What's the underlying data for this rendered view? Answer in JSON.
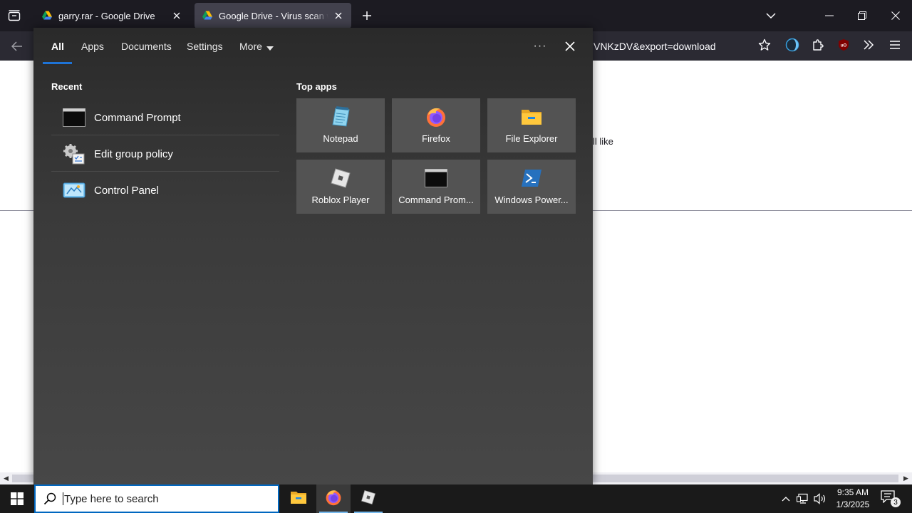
{
  "browser": {
    "tabs": [
      {
        "title": "garry.rar - Google Drive",
        "favicon": "google-drive-icon",
        "active": false
      },
      {
        "title": "Google Drive - Virus scan warning",
        "favicon": "google-drive-icon",
        "active": true
      }
    ],
    "url_visible_text": "VNKzDV&export=download",
    "page_partial_text": "ll like"
  },
  "search_flyout": {
    "tabs": [
      "All",
      "Apps",
      "Documents",
      "Settings",
      "More"
    ],
    "active_tab": "All",
    "recent_title": "Recent",
    "recent": [
      {
        "label": "Command Prompt",
        "icon": "command-prompt-icon"
      },
      {
        "label": "Edit group policy",
        "icon": "group-policy-icon"
      },
      {
        "label": "Control Panel",
        "icon": "control-panel-icon"
      }
    ],
    "top_apps_title": "Top apps",
    "top_apps": [
      {
        "label": "Notepad",
        "icon": "notepad-icon"
      },
      {
        "label": "Firefox",
        "icon": "firefox-icon"
      },
      {
        "label": "File Explorer",
        "icon": "file-explorer-icon"
      },
      {
        "label": "Roblox Player",
        "icon": "roblox-icon"
      },
      {
        "label": "Command Prom...",
        "icon": "command-prompt-icon"
      },
      {
        "label": "Windows Power...",
        "icon": "powershell-icon"
      }
    ]
  },
  "taskbar": {
    "search_placeholder": "Type here to search",
    "clock_time": "9:35 AM",
    "clock_date": "1/3/2025",
    "notification_count": "3"
  },
  "colors": {
    "accent": "#0067c0",
    "tab_underline": "#1e73d6",
    "firefox_tabbar": "#1c1b22",
    "firefox_toolbar": "#2b2a33"
  }
}
